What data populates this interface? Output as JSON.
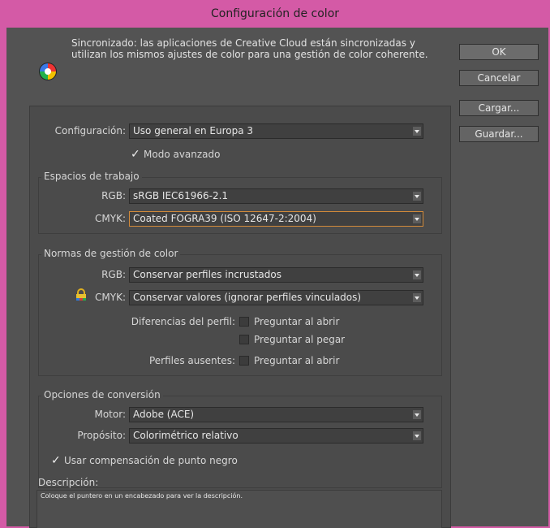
{
  "window": {
    "title": "Configuración de color"
  },
  "sync": {
    "message": "Sincronizado: las aplicaciones de Creative Cloud están sincronizadas y utilizan los mismos ajustes de color para una gestión de color coherente."
  },
  "buttons": {
    "ok": "OK",
    "cancel": "Cancelar",
    "load": "Cargar...",
    "save": "Guardar..."
  },
  "settings": {
    "label": "Configuración:",
    "value": "Uso general en Europa 3",
    "advanced_mode": {
      "label": "Modo avanzado",
      "checked": true
    }
  },
  "working_spaces": {
    "title": "Espacios de trabajo",
    "rgb": {
      "label": "RGB:",
      "value": "sRGB IEC61966-2.1"
    },
    "cmyk": {
      "label": "CMYK:",
      "value": "Coated FOGRA39 (ISO 12647-2:2004)"
    }
  },
  "policies": {
    "title": "Normas de gestión de color",
    "rgb": {
      "label": "RGB:",
      "value": "Conservar perfiles incrustados"
    },
    "cmyk": {
      "label": "CMYK:",
      "value": "Conservar valores (ignorar perfiles vinculados)"
    },
    "mismatch_label": "Diferencias del perfil:",
    "ask_open": "Preguntar al abrir",
    "ask_paste": "Preguntar al pegar",
    "missing_label": "Perfiles ausentes:",
    "missing_ask_open": "Preguntar al abrir"
  },
  "conversion": {
    "title": "Opciones de conversión",
    "engine": {
      "label": "Motor:",
      "value": "Adobe (ACE)"
    },
    "intent": {
      "label": "Propósito:",
      "value": "Colorimétrico relativo"
    },
    "black_point": {
      "label": "Usar compensación de punto negro",
      "checked": true
    }
  },
  "description": {
    "title": "Descripción:",
    "text": "Coloque el puntero en un encabezado para ver la descripción."
  }
}
